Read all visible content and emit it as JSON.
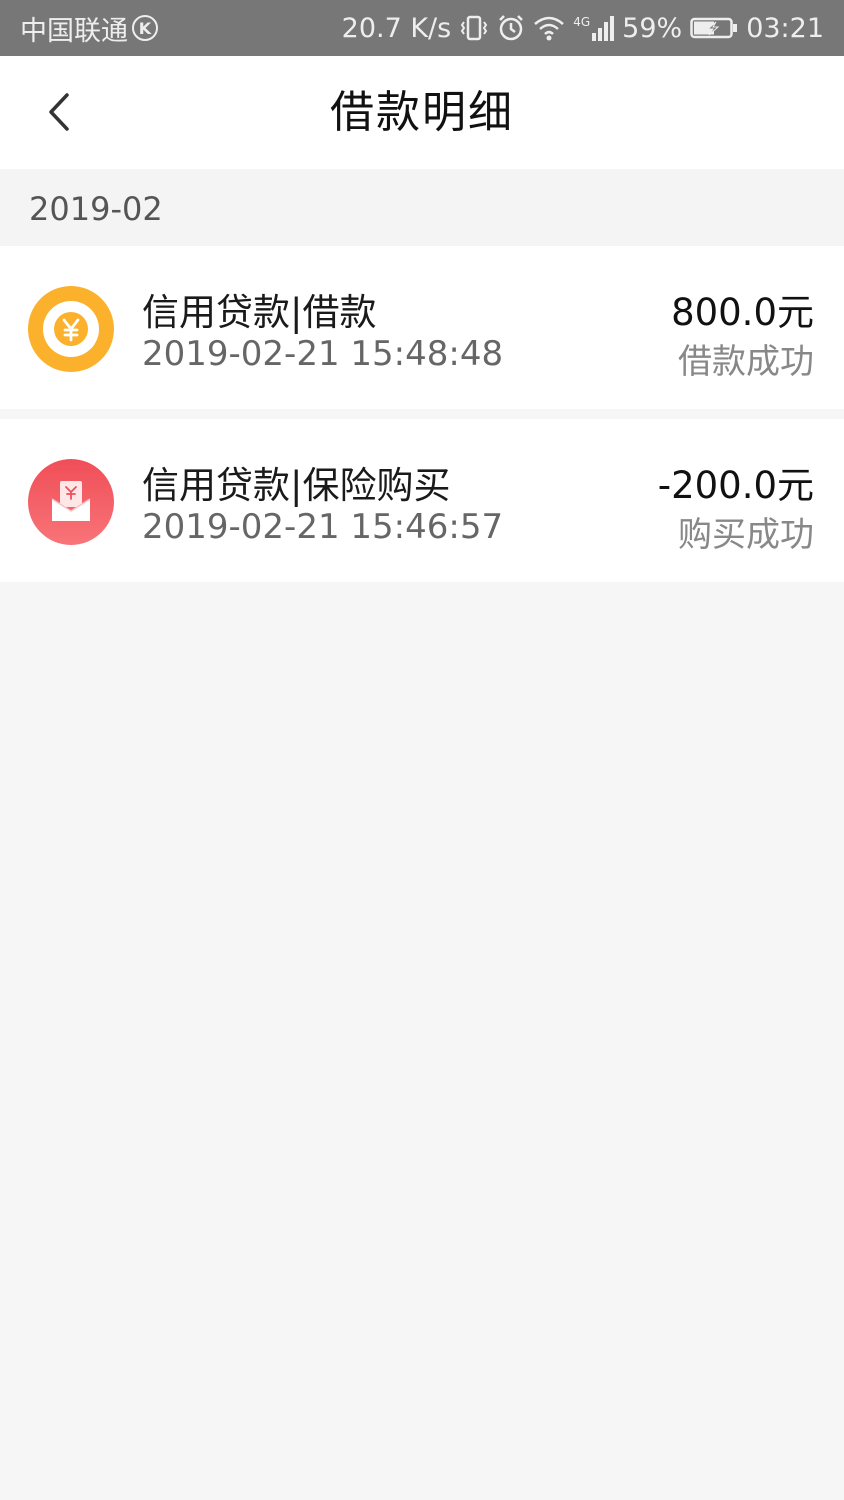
{
  "status_bar": {
    "carrier": "中国联通",
    "carrier_badge": "K",
    "network_speed": "20.7 K/s",
    "network_type": "4G",
    "battery": "59%",
    "time": "03:21",
    "icons": [
      "vibrate-icon",
      "alarm-icon",
      "wifi-icon",
      "signal-icon",
      "battery-charging-icon"
    ]
  },
  "header": {
    "title": "借款明细",
    "back_icon": "chevron-left-icon"
  },
  "month_group": {
    "label": "2019-02"
  },
  "records": [
    {
      "title": "信用贷款|借款",
      "datetime": "2019-02-21 15:48:48",
      "amount": "800.0元",
      "status": "借款成功",
      "icon": "yuan-coin-icon",
      "icon_color": "#FBB12C"
    },
    {
      "title": "信用贷款|保险购买",
      "datetime": "2019-02-21 15:46:57",
      "amount": "-200.0元",
      "status": "购买成功",
      "icon": "red-envelope-icon",
      "icon_color": "#F2565E"
    }
  ],
  "colors": {
    "status_bar_bg": "#777777",
    "page_bg": "#F6F6F6",
    "card_bg": "#FFFFFF"
  }
}
